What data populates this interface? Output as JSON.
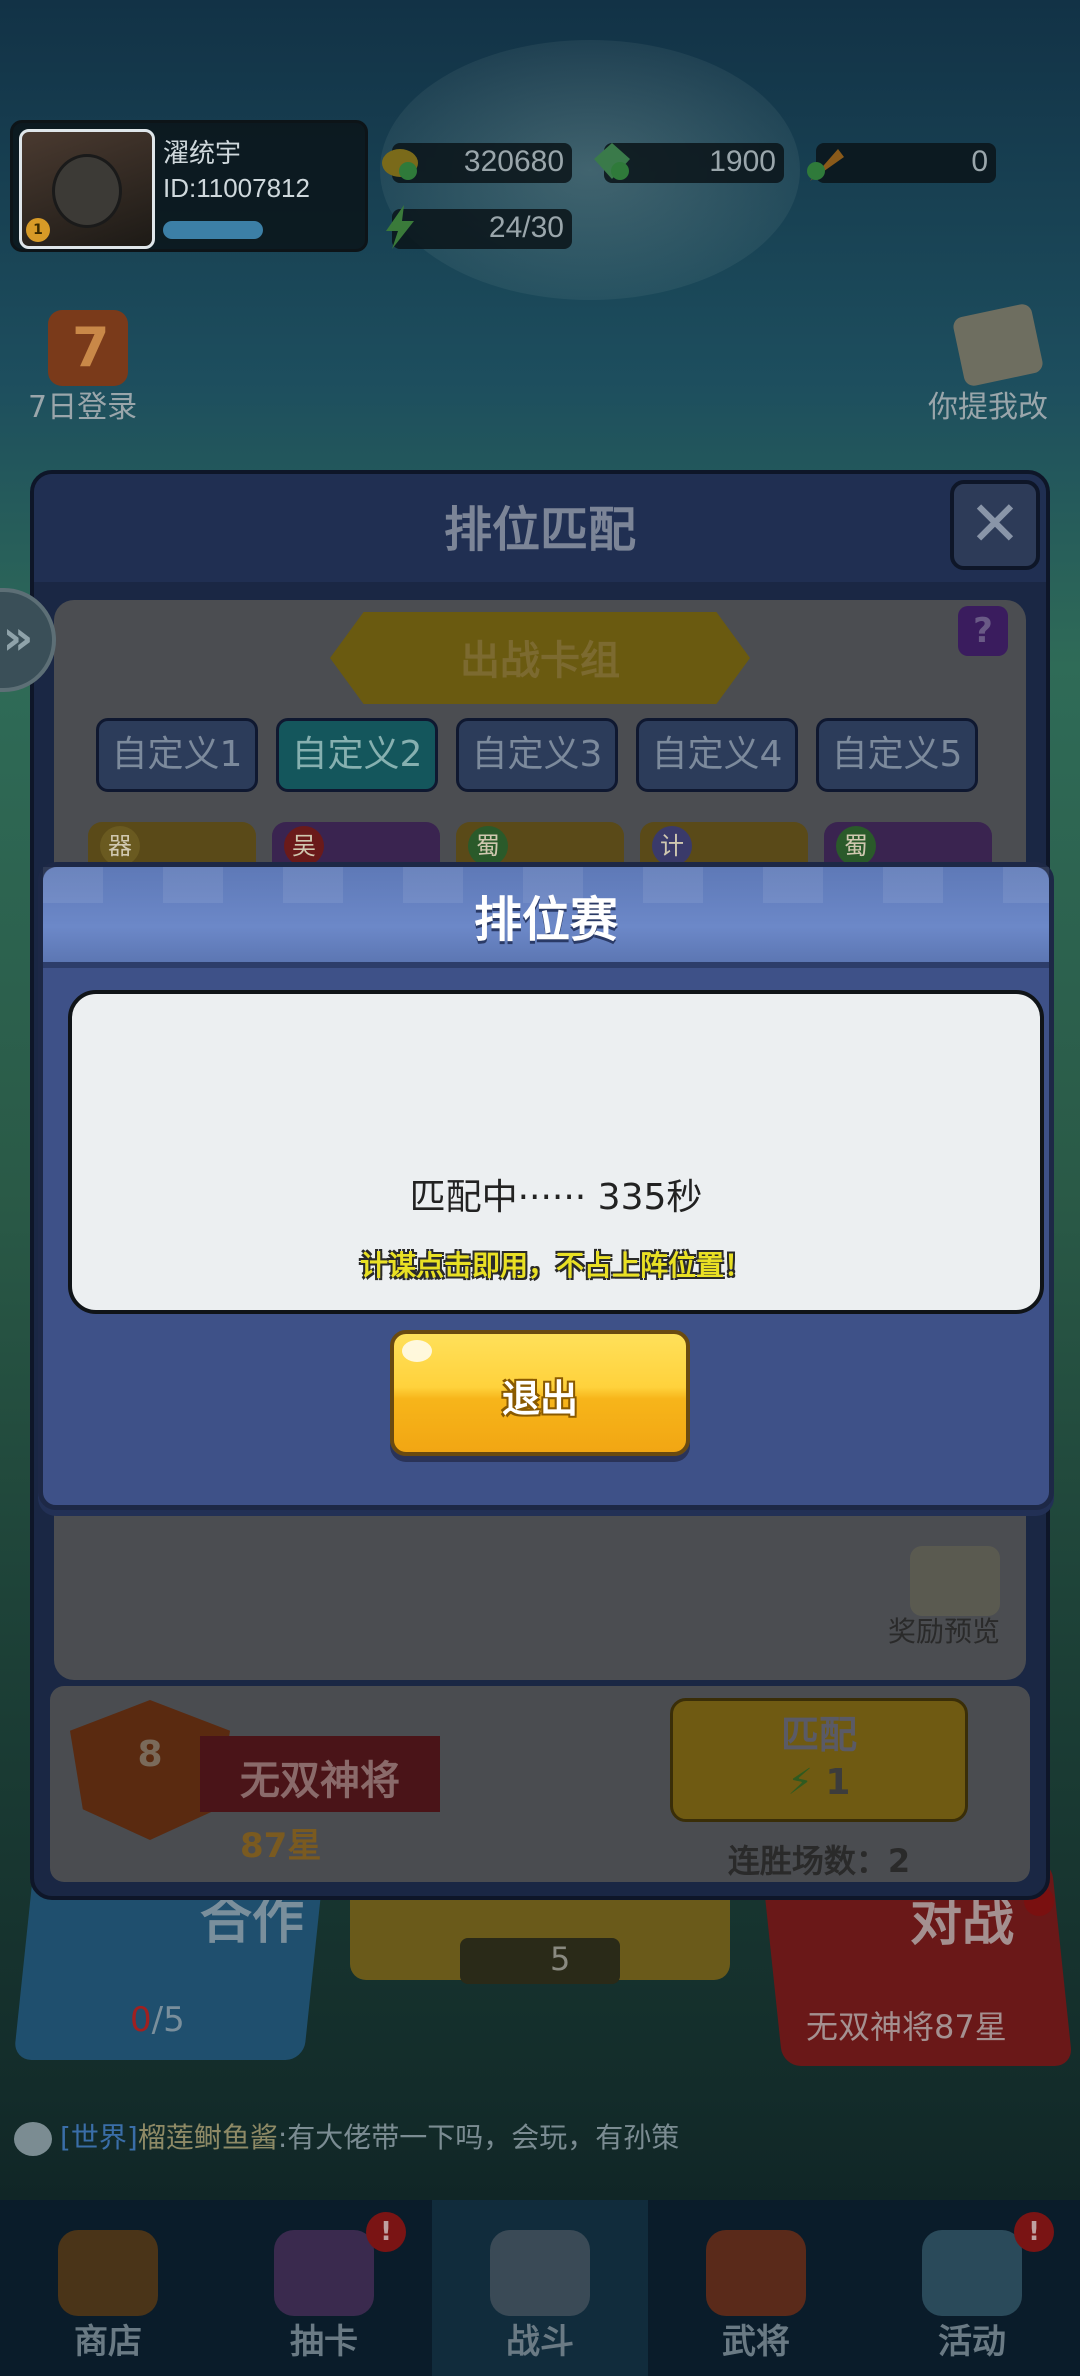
{
  "player": {
    "name": "濯统宇",
    "id": "ID:11007812",
    "level_badge": "1"
  },
  "resources": {
    "gold": "320680",
    "gems": "1900",
    "carrots": "0",
    "energy": "24/30"
  },
  "side_buttons": {
    "seven_day_number": "7",
    "seven_day_label": "7日登录",
    "feedback_label": "你提我改"
  },
  "side_toggle_icon": "double-chevron-right-icon",
  "rank_panel": {
    "title": "排位匹配",
    "close_glyph": "✕",
    "help_glyph": "?",
    "deck_label": "出战卡组",
    "deck_tabs": [
      "自定义1",
      "自定义2",
      "自定义3",
      "自定义4",
      "自定义5"
    ],
    "selected_tab_index": 1,
    "card_tags": [
      "器",
      "吴",
      "蜀",
      "计",
      "蜀"
    ],
    "reward_preview_label": "奖励预览",
    "rank_level": "8",
    "rank_name": "无双神将",
    "rank_stars": "87星",
    "match_button_label": "匹配",
    "match_cost": "1",
    "win_streak": "连胜场数：2"
  },
  "dialog": {
    "title": "排位赛",
    "status": "匹配中······ 335秒",
    "hint": "计谋点击即用，不占上阵位置！",
    "exit_label": "退出"
  },
  "home": {
    "coop_title": "合作",
    "coop_count_current": "0",
    "coop_count_total": "/5",
    "mid_energy": "5",
    "battle_title": "对战",
    "battle_sub": "无双神将87星"
  },
  "chat": {
    "channel": "[世界]",
    "sender": "榴莲鲥鱼酱",
    "message": ":有大佬带一下吗，会玩，有孙策"
  },
  "bottom_nav": [
    {
      "label": "商店",
      "icon": "shop-icon",
      "badge": ""
    },
    {
      "label": "抽卡",
      "icon": "card-draw-icon",
      "badge": "!"
    },
    {
      "label": "战斗",
      "icon": "battle-icon",
      "badge": ""
    },
    {
      "label": "武将",
      "icon": "general-icon",
      "badge": ""
    },
    {
      "label": "活动",
      "icon": "event-icon",
      "badge": "!"
    }
  ],
  "colors": {
    "dialog_bg": "#3e5188",
    "dialog_header": "#6c88c8",
    "exit_button": "#ffd23c",
    "hint_text": "#e9e024"
  }
}
